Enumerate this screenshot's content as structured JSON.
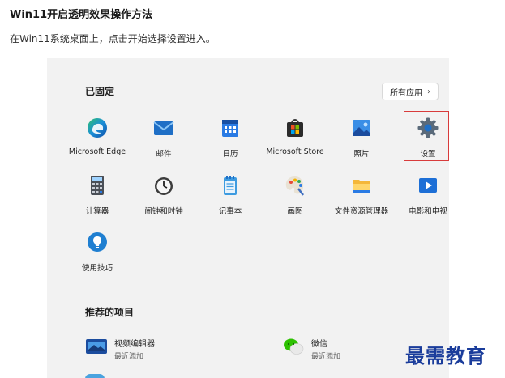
{
  "article": {
    "title": "Win11开启透明效果操作方法",
    "paragraph": "在Win11系统桌面上，点击开始选择设置进入。"
  },
  "start_menu": {
    "pinned_title": "已固定",
    "all_apps_label": "所有应用",
    "pinned_apps": [
      {
        "label": "Microsoft Edge",
        "icon": "edge-icon"
      },
      {
        "label": "邮件",
        "icon": "mail-icon"
      },
      {
        "label": "日历",
        "icon": "calendar-icon"
      },
      {
        "label": "Microsoft Store",
        "icon": "store-icon"
      },
      {
        "label": "照片",
        "icon": "photos-icon"
      },
      {
        "label": "设置",
        "icon": "settings-gear-icon"
      },
      {
        "label": "计算器",
        "icon": "calculator-icon"
      },
      {
        "label": "闹钟和时钟",
        "icon": "alarm-clock-icon"
      },
      {
        "label": "记事本",
        "icon": "notepad-icon"
      },
      {
        "label": "画图",
        "icon": "paint-icon"
      },
      {
        "label": "文件资源管理器",
        "icon": "file-explorer-icon"
      },
      {
        "label": "电影和电视",
        "icon": "movies-tv-icon"
      },
      {
        "label": "使用技巧",
        "icon": "tips-icon"
      }
    ],
    "recommended_title": "推荐的项目",
    "recommended": [
      {
        "name": "视频编辑器",
        "sub": "最近添加",
        "icon": "video-editor-icon"
      },
      {
        "name": "微信",
        "sub": "最近添加",
        "icon": "wechat-icon"
      }
    ]
  },
  "watermark": "最需教育"
}
